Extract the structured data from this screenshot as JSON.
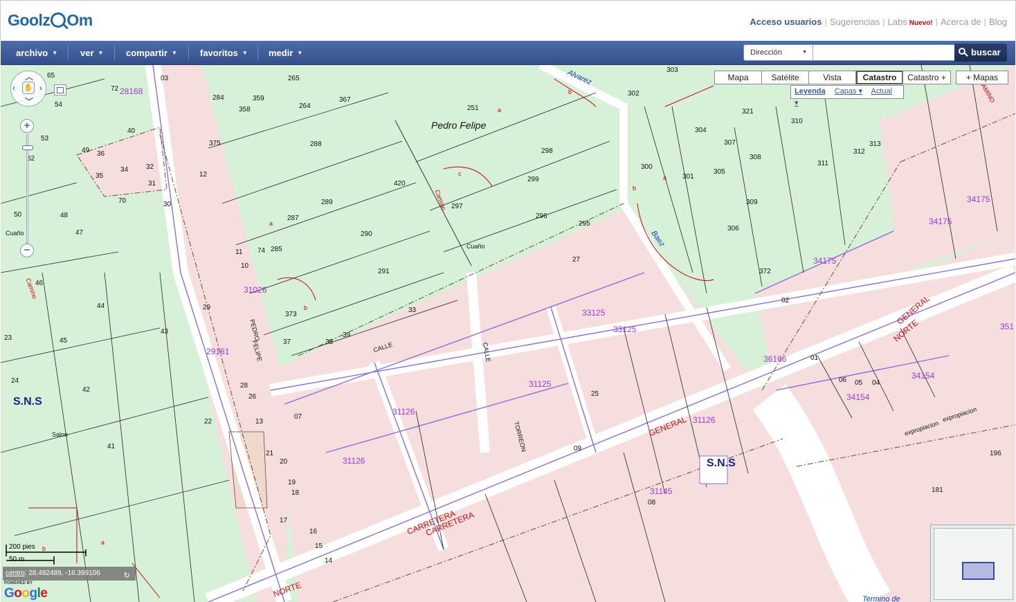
{
  "header": {
    "logo": "Goolzoom",
    "links": [
      "Acceso usuarios",
      "Sugerencias",
      "Labs",
      "Acerca de",
      "Blog"
    ],
    "labs_badge": "Nuevo!"
  },
  "menu": {
    "items": [
      "archivo",
      "ver",
      "compartir",
      "favoritos",
      "medir"
    ],
    "search_type": "Dirección",
    "search_value": "",
    "search_button": "buscar"
  },
  "map_controls": {
    "types": [
      "Mapa",
      "Satélite",
      "Vista",
      "Catastro",
      "Catastro +",
      "+ Mapas"
    ],
    "active_type": "Catastro",
    "submenu": [
      "Leyenda",
      "Capas ▾",
      "Actual ▾"
    ],
    "scale_imperial": "200 pies",
    "scale_metric": "50 m",
    "coords_label": "centro",
    "coords_value": ": 28.482489, -16.399106",
    "powered": "POWERED BY",
    "google": "Google"
  },
  "map_labels": {
    "numbers": [
      "03",
      "265",
      "284",
      "359",
      "264",
      "367",
      "358",
      "288",
      "12",
      "375",
      "420",
      "289",
      "287",
      "290",
      "291",
      "11",
      "10",
      "285",
      "74",
      "30",
      "29",
      "31",
      "33",
      "32",
      "34",
      "35",
      "36",
      "37",
      "38",
      "39",
      "40",
      "49",
      "53",
      "48",
      "47",
      "46",
      "45",
      "44",
      "43",
      "42",
      "41",
      "70",
      "50",
      "52",
      "54",
      "65",
      "72",
      "23",
      "24",
      "21",
      "20",
      "19",
      "18",
      "17",
      "16",
      "15",
      "14",
      "13",
      "22",
      "25",
      "26",
      "27",
      "28",
      "251",
      "298",
      "299",
      "297",
      "296",
      "295",
      "302",
      "300",
      "301",
      "303",
      "304",
      "305",
      "306",
      "307",
      "308",
      "309",
      "310",
      "311",
      "312",
      "313",
      "321",
      "373",
      "372",
      "02",
      "01",
      "06",
      "05",
      "04",
      "07",
      "08",
      "09",
      "196",
      "181",
      "373"
    ],
    "blocks": [
      "28168",
      "31026",
      "29161",
      "33125",
      "33125",
      "31126",
      "31126",
      "31126",
      "31125",
      "31145",
      "36166",
      "34175",
      "34175",
      "34175",
      "34154",
      "34154",
      "351"
    ],
    "names": [
      "Pedro Felipe",
      "Cuaño",
      "Cuaño",
      "Salon",
      "Camino",
      "Camino",
      "S.N.S",
      "S.N.S",
      "Alvarez",
      "Baez",
      "CALLE",
      "CALLE",
      "PEDRO",
      "FELIPE",
      "TORREON",
      "CARRETERA",
      "CARRETERA",
      "GENERAL",
      "GENERAL",
      "NORTE",
      "NORTE",
      "expropiacion",
      "expropiacion",
      "Termino de",
      "CAMINO"
    ],
    "letters": [
      "a",
      "b",
      "c"
    ]
  }
}
